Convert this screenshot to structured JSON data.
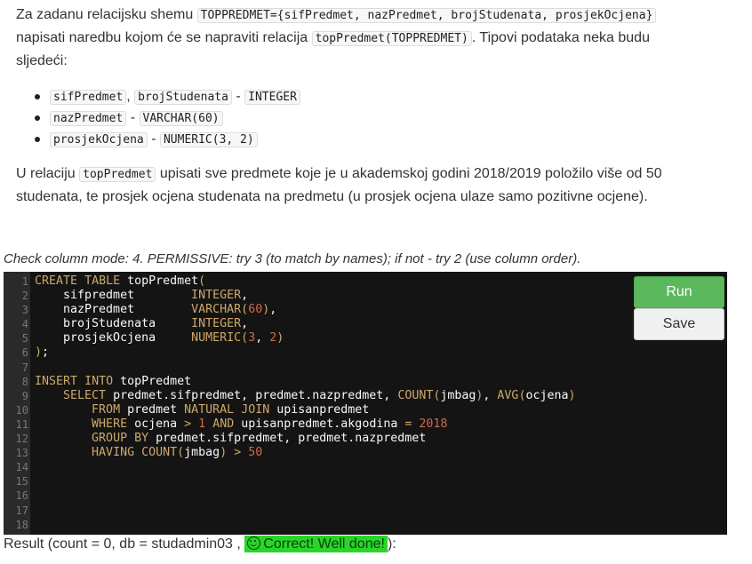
{
  "task": {
    "p1_a": "Za zadanu relacijsku shemu ",
    "p1_code1": "TOPPREDMET={sifPredmet, nazPredmet, brojStudenata, prosjekOcjena}",
    "p1_b": "napisati naredbu kojom će se napraviti relacija ",
    "p1_code2": "topPredmet(TOPPREDMET)",
    "p1_c": ". Tipovi podataka neka budu",
    "p1_d": "sljedeći:",
    "bullets": [
      {
        "a": "sifPredmet",
        "sep": ", ",
        "b": "brojStudenata",
        "dash": " - ",
        "type": "INTEGER"
      },
      {
        "a": "nazPredmet",
        "dash": " - ",
        "type": "VARCHAR(60)"
      },
      {
        "a": "prosjekOcjena",
        "dash": " - ",
        "type": "NUMERIC(3, 2)"
      }
    ],
    "p2_a": "U relaciju ",
    "p2_code": "topPredmet",
    "p2_b": " upisati sve predmete koje je u akademskoj godini 2018/2019 položilo više od 50",
    "p2_c": "studenata, te prosjek ocjena studenata na predmetu (u prosjek ocjena ulaze samo pozitivne ocjene)."
  },
  "mode_text": "Check column mode: 4. PERMISSIVE: try 3 (to match by names); if not - try 2 (use column order).",
  "editor": {
    "line_numbers": [
      "1",
      "2",
      "3",
      "4",
      "5",
      "6",
      "7",
      "8",
      "9",
      "10",
      "11",
      "12",
      "13",
      "14",
      "15",
      "16",
      "17",
      "18"
    ],
    "lines": [
      "CREATE TABLE topPredmet(",
      "    sifpredmet        INTEGER,",
      "    nazPredmet        VARCHAR(60),",
      "    brojStudenata     INTEGER,",
      "    prosjekOcjena     NUMERIC(3, 2)",
      ");",
      "",
      "INSERT INTO topPredmet",
      "    SELECT predmet.sifpredmet, predmet.nazpredmet, COUNT(jmbag), AVG(ocjena)",
      "        FROM predmet NATURAL JOIN upisanpredmet",
      "        WHERE ocjena > 1 AND upisanpredmet.akgodina = 2018",
      "        GROUP BY predmet.sifpredmet, predmet.nazpredmet",
      "        HAVING COUNT(jmbag) > 50",
      "",
      "",
      "",
      "",
      ""
    ],
    "run_label": "Run",
    "save_label": "Save"
  },
  "result": {
    "prefix": "Result (count = 0, db = studadmin03 , ",
    "status": "Correct! Well done!",
    "suffix": "):",
    "icon": "smiley-icon",
    "status_color": "#2ad52a"
  }
}
